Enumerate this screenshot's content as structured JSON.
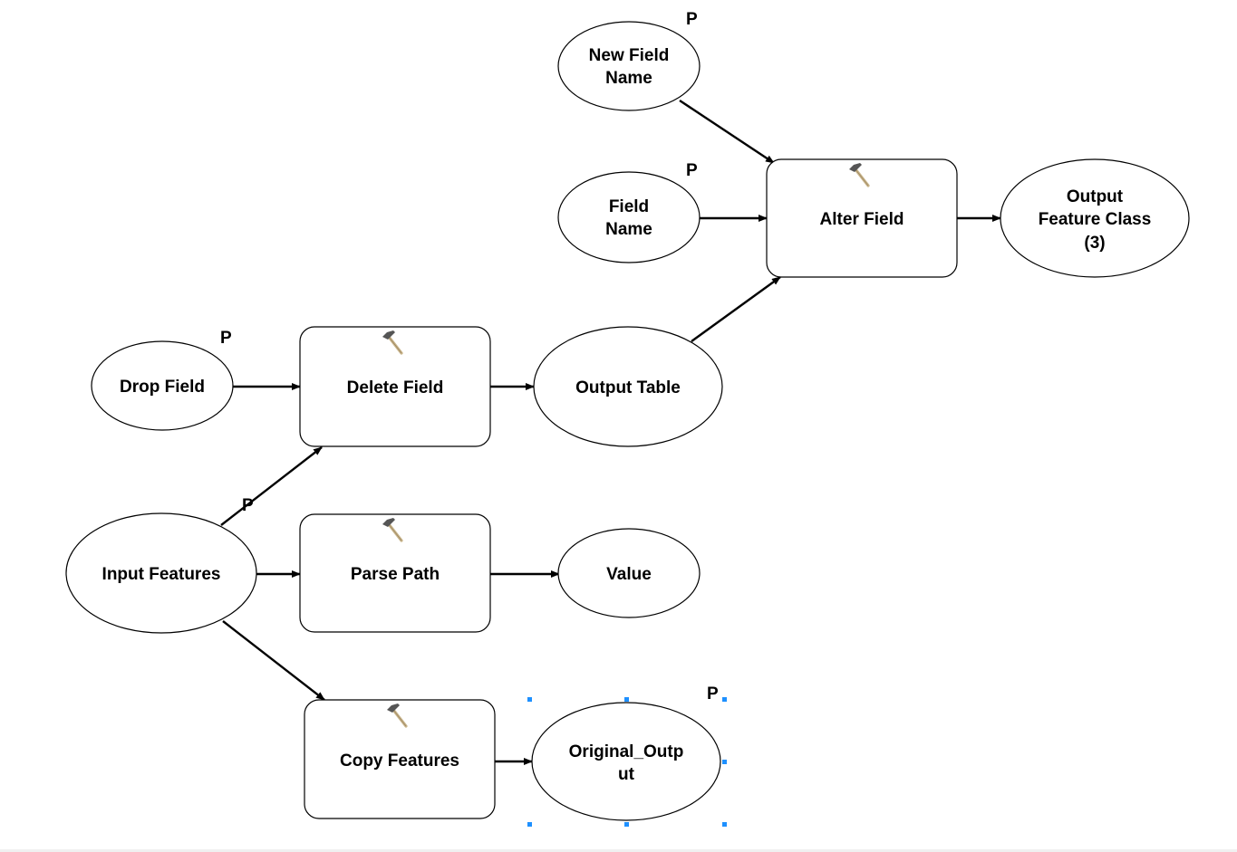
{
  "diagram": {
    "variables": {
      "new_field_name": {
        "label": [
          "New Field",
          "Name"
        ],
        "parameter_flag": "P"
      },
      "field_name": {
        "label": [
          "Field",
          "Name"
        ],
        "parameter_flag": "P"
      },
      "output_feature_class_3": {
        "label": [
          "Output",
          "Feature Class",
          "(3)"
        ]
      },
      "drop_field": {
        "label": [
          "Drop Field"
        ],
        "parameter_flag": "P"
      },
      "output_table": {
        "label": [
          "Output Table"
        ]
      },
      "input_features": {
        "label": [
          "Input Features"
        ],
        "parameter_flag": "P"
      },
      "value": {
        "label": [
          "Value"
        ]
      },
      "original_output": {
        "label": [
          "Original_Outp",
          "ut"
        ],
        "parameter_flag": "P",
        "selected": true
      }
    },
    "tools": {
      "alter_field": {
        "label": "Alter Field",
        "icon": "hammer-icon"
      },
      "delete_field": {
        "label": "Delete Field",
        "icon": "hammer-icon"
      },
      "parse_path": {
        "label": "Parse Path",
        "icon": "hammer-icon"
      },
      "copy_features": {
        "label": "Copy Features",
        "icon": "hammer-icon"
      }
    },
    "connections": [
      [
        "New Field Name",
        "Alter Field"
      ],
      [
        "Field Name",
        "Alter Field"
      ],
      [
        "Alter Field",
        "Output Feature Class (3)"
      ],
      [
        "Output Table",
        "Alter Field"
      ],
      [
        "Drop Field",
        "Delete Field"
      ],
      [
        "Delete Field",
        "Output Table"
      ],
      [
        "Input Features",
        "Delete Field"
      ],
      [
        "Input Features",
        "Parse Path"
      ],
      [
        "Parse Path",
        "Value"
      ],
      [
        "Input Features",
        "Copy Features"
      ],
      [
        "Copy Features",
        "Original_Output"
      ]
    ],
    "selection_color": "#1e90ff"
  }
}
